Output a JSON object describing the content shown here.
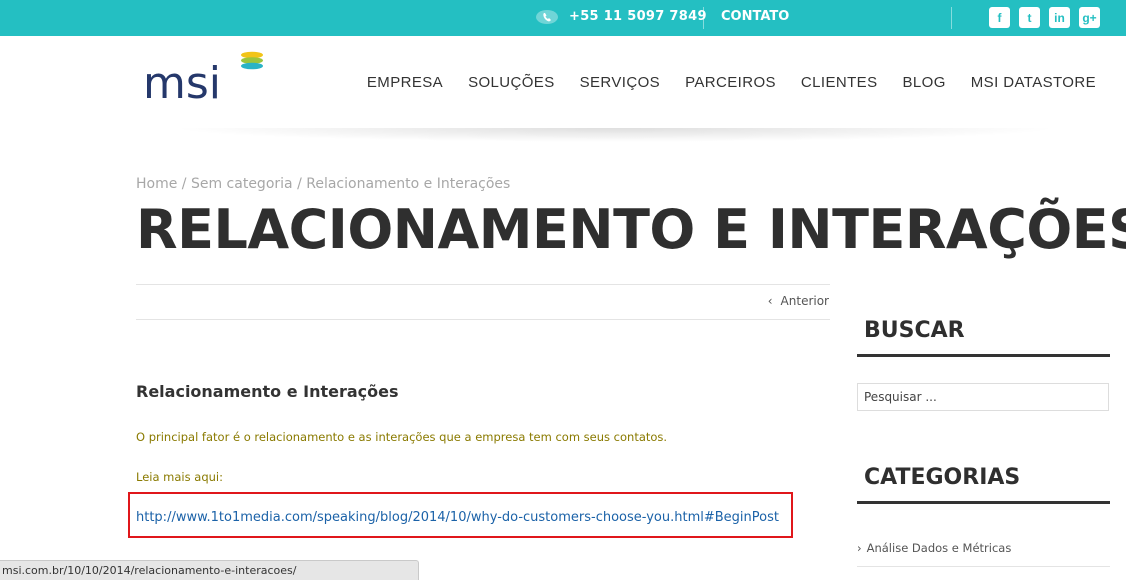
{
  "topbar": {
    "phone": "+55 11 5097 7849",
    "contact_label": "CONTATO",
    "social": [
      {
        "icon": "facebook-icon",
        "glyph": "f"
      },
      {
        "icon": "twitter-icon",
        "glyph": "t"
      },
      {
        "icon": "linkedin-icon",
        "glyph": "in"
      },
      {
        "icon": "google-plus-icon",
        "glyph": "g+"
      }
    ],
    "bg_color": "#24bfc2"
  },
  "header": {
    "logo_text": "msi",
    "nav": [
      "EMPRESA",
      "SOLUÇÕES",
      "SERVIÇOS",
      "PARCEIROS",
      "CLIENTES",
      "BLOG",
      "MSI DATASTORE"
    ]
  },
  "breadcrumb": {
    "home": "Home",
    "sep": "/",
    "category": "Sem categoria",
    "current": "Relacionamento e Interações"
  },
  "page": {
    "title": "RELACIONAMENTO E INTERAÇÕES",
    "prev_label": "Anterior"
  },
  "post": {
    "title": "Relacionamento e Interações",
    "paragraph": "O principal fator é o relacionamento e as interações que a empresa tem com seus contatos.",
    "read_more": "Leia mais aqui:",
    "link": "http://www.1to1media.com/speaking/blog/2014/10/why-do-customers-choose-you.html#BeginPost"
  },
  "sidebar": {
    "search_title": "BUSCAR",
    "search_placeholder": "Pesquisar ...",
    "categories_title": "CATEGORIAS",
    "categories": [
      "Análise Dados e Métricas"
    ]
  },
  "statusbar": {
    "url": "msi.com.br/10/10/2014/relacionamento-e-interacoes/"
  }
}
